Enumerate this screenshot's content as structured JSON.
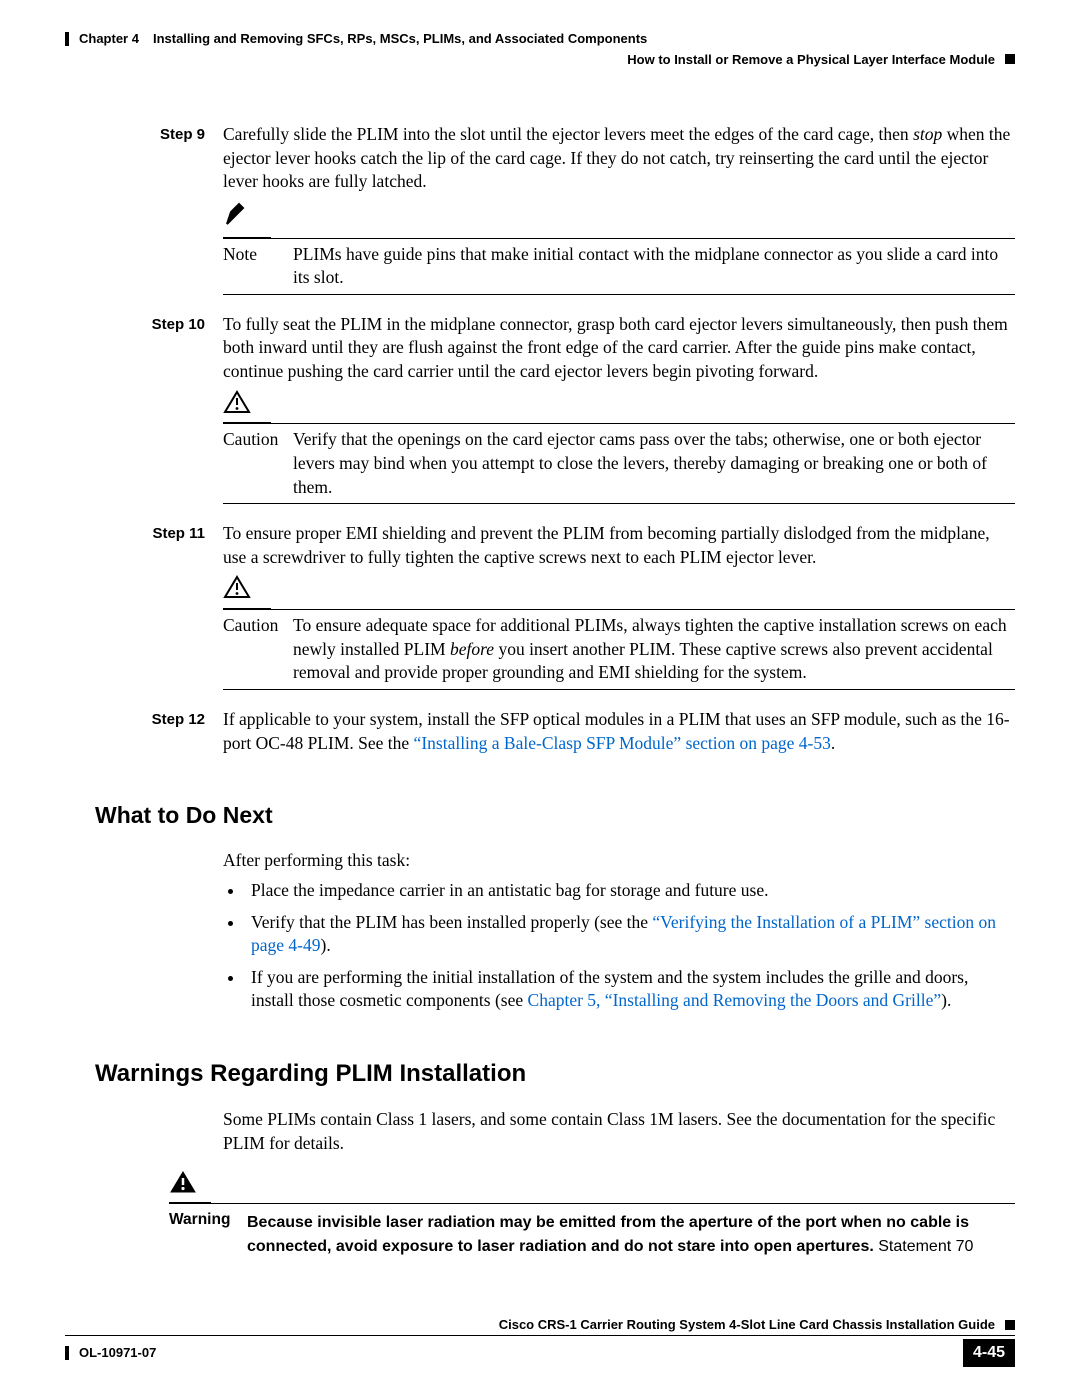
{
  "header": {
    "chapter_label": "Chapter 4",
    "chapter_title": "Installing and Removing SFCs, RPs, MSCs, PLIMs, and Associated Components",
    "section_title": "How to Install or Remove a Physical Layer Interface Module"
  },
  "steps": [
    {
      "label": "Step 9",
      "text_before_italic": "Carefully slide the PLIM into the slot until the ejector levers meet the edges of the card cage, then ",
      "italic_word": "stop",
      "text_after_italic": " when the ejector lever hooks catch the lip of the card cage. If they do not catch, try reinserting the card until the ejector lever hooks are fully latched.",
      "note": {
        "label": "Note",
        "icon": "pen-icon",
        "text": "PLIMs have guide pins that make initial contact with the midplane connector as you slide a card into its slot."
      }
    },
    {
      "label": "Step 10",
      "text": "To fully seat the PLIM in the midplane connector, grasp both card ejector levers simultaneously, then push them both inward until they are flush against the front edge of the card carrier. After the guide pins make contact, continue pushing the card carrier until the card ejector levers begin pivoting forward.",
      "caution": {
        "label": "Caution",
        "icon": "caution-triangle-icon",
        "text": "Verify that the openings on the card ejector cams pass over the tabs; otherwise, one or both ejector levers may bind when you attempt to close the levers, thereby damaging or breaking one or both of them."
      }
    },
    {
      "label": "Step 11",
      "text": "To ensure proper EMI shielding and prevent the PLIM from becoming partially dislodged from the midplane, use a screwdriver to fully tighten the captive screws next to each PLIM ejector lever.",
      "caution": {
        "label": "Caution",
        "icon": "caution-triangle-icon",
        "text_before_italic": "To ensure adequate space for additional PLIMs, always tighten the captive installation screws on each newly installed PLIM ",
        "italic_word": "before",
        "text_after_italic": " you insert another PLIM. These captive screws also prevent accidental removal and provide proper grounding and EMI shielding for the system."
      }
    },
    {
      "label": "Step 12",
      "text_before_link": "If applicable to your system, install the SFP optical modules in a PLIM that uses an SFP module, such as the 16-port OC-48 PLIM. See the ",
      "link_text": "“Installing a Bale-Clasp SFP Module” section on page 4-53",
      "text_after_link": "."
    }
  ],
  "what_next": {
    "heading": "What to Do Next",
    "intro": "After performing this task:",
    "bullets": [
      {
        "text": "Place the impedance carrier in an antistatic bag for storage and future use."
      },
      {
        "text_before_link": "Verify that the PLIM has been installed properly (see the ",
        "link_text": "“Verifying the Installation of a PLIM” section on page 4-49",
        "text_after_link": ")."
      },
      {
        "text_before_link": "If you are performing the initial installation of the system and the system includes the grille and doors, install those cosmetic components (see ",
        "link_text": "Chapter 5, “Installing and Removing the Doors and Grille”",
        "text_after_link": ")."
      }
    ]
  },
  "warnings_section": {
    "heading": "Warnings Regarding PLIM Installation",
    "intro": "Some PLIMs contain Class 1 lasers, and some contain Class 1M lasers. See the documentation for the specific PLIM for details.",
    "warning": {
      "label": "Warning",
      "icon": "warning-triangle-icon",
      "bold_text": "Because invisible laser radiation may be emitted from the aperture of the port when no cable is connected, avoid exposure to laser radiation and do not stare into open apertures. ",
      "statement": "Statement 70"
    }
  },
  "footer": {
    "guide_title": "Cisco CRS-1 Carrier Routing System 4-Slot Line Card Chassis Installation Guide",
    "doc_id": "OL-10971-07",
    "page_num": "4-45"
  }
}
